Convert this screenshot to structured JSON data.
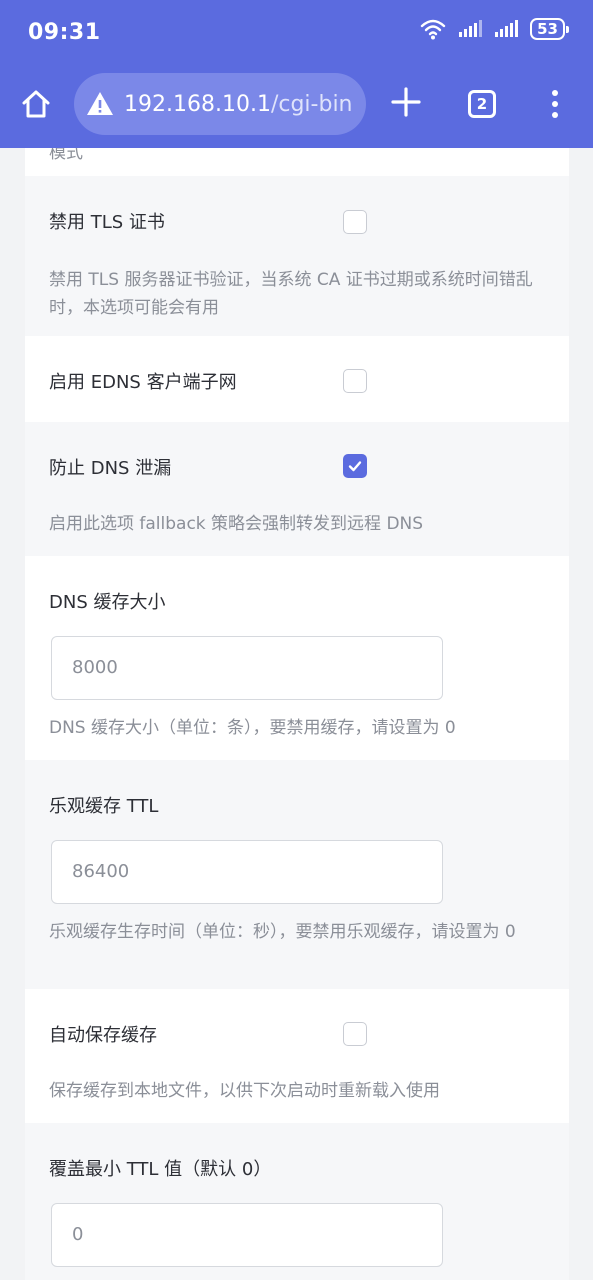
{
  "status_bar": {
    "time": "09:31",
    "battery": "53",
    "icons": [
      "wifi-icon",
      "signal-icon",
      "signal-icon",
      "battery-icon"
    ]
  },
  "browser": {
    "url_host": "192.168.10.1",
    "url_path": "/cgi-bin",
    "tab_count": "2",
    "accent": "#5b6bdf"
  },
  "settings": {
    "cut_text": "模式",
    "disable_tls": {
      "label": "禁用 TLS 证书",
      "checked": false,
      "desc": "禁用 TLS 服务器证书验证，当系统 CA 证书过期或系统时间错乱时，本选项可能会有用"
    },
    "edns": {
      "label": "启用 EDNS 客户端子网",
      "checked": false
    },
    "dns_leak": {
      "label": "防止 DNS 泄漏",
      "checked": true,
      "desc": "启用此选项 fallback 策略会强制转发到远程 DNS"
    },
    "cache_size": {
      "label": "DNS 缓存大小",
      "value": "8000",
      "desc": "DNS 缓存大小（单位：条），要禁用缓存，请设置为 0"
    },
    "optimistic_ttl": {
      "label": "乐观缓存 TTL",
      "value": "86400",
      "desc": "乐观缓存生存时间（单位：秒），要禁用乐观缓存，请设置为 0"
    },
    "auto_save": {
      "label": "自动保存缓存",
      "checked": false,
      "desc": "保存缓存到本地文件，以供下次启动时重新载入使用"
    },
    "min_ttl": {
      "label": "覆盖最小 TTL 值（默认 0）",
      "value": "0"
    }
  }
}
